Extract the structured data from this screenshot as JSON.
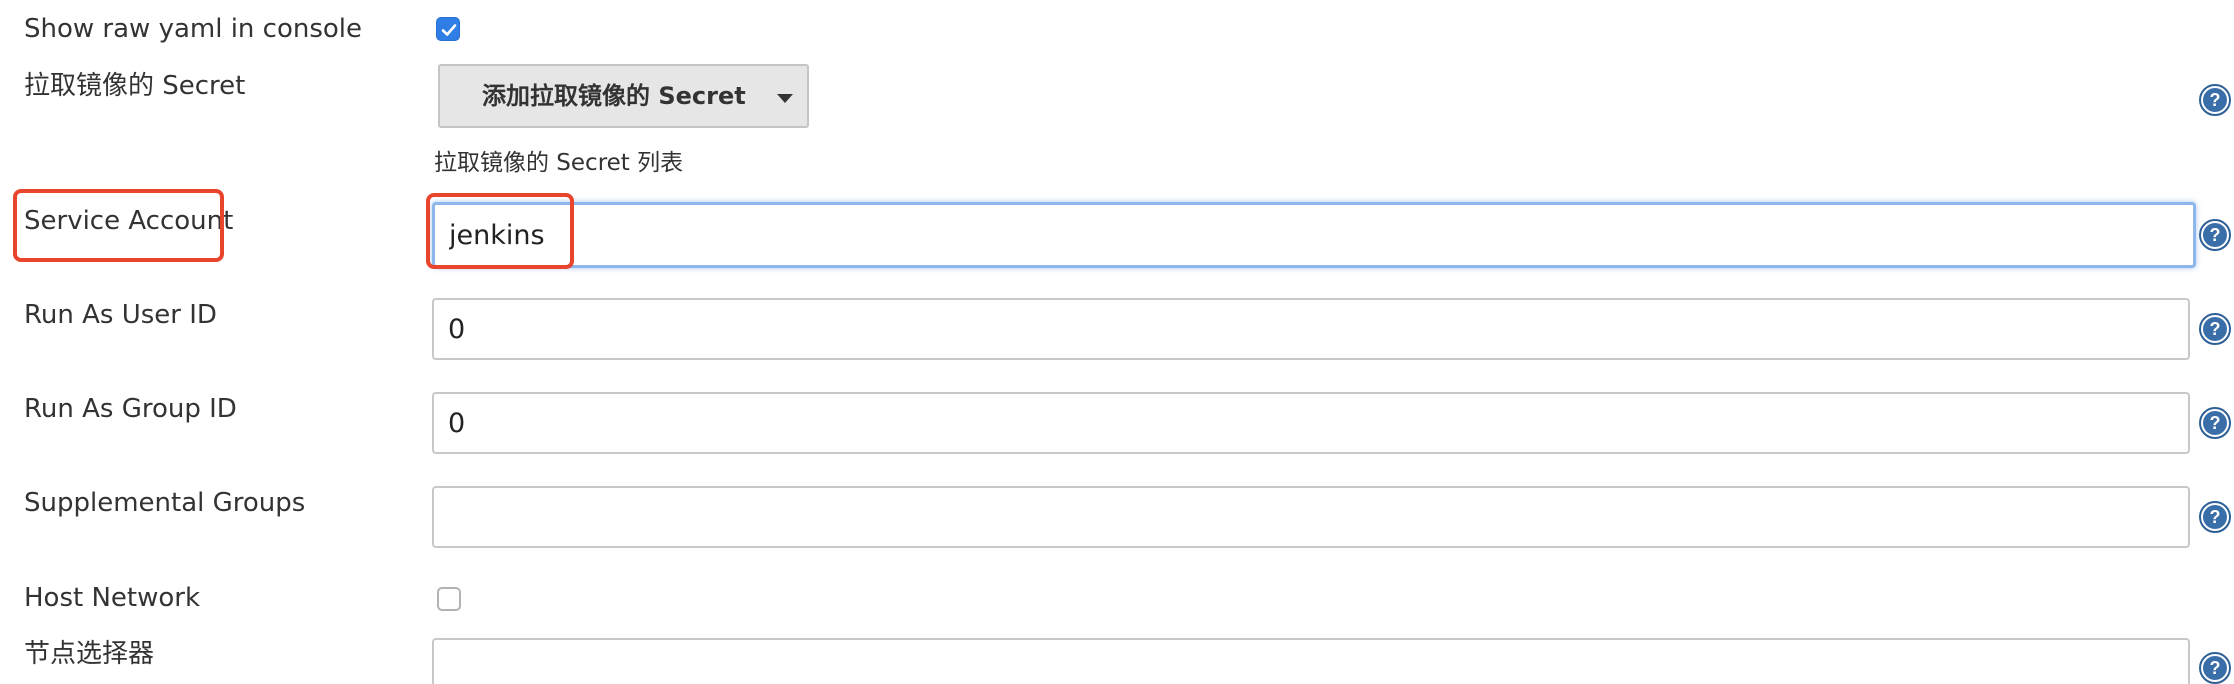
{
  "form": {
    "show_raw_yaml": {
      "label": "Show raw yaml in console",
      "checked": true
    },
    "image_pull_secret": {
      "label": "拉取镜像的 Secret",
      "button_label": "添加拉取镜像的 Secret",
      "hint": "拉取镜像的 Secret 列表"
    },
    "service_account": {
      "label": "Service Account",
      "value": "jenkins"
    },
    "run_as_user_id": {
      "label": "Run As User ID",
      "value": "0"
    },
    "run_as_group_id": {
      "label": "Run As Group ID",
      "value": "0"
    },
    "supplemental_groups": {
      "label": "Supplemental Groups",
      "value": ""
    },
    "host_network": {
      "label": "Host Network",
      "checked": false
    },
    "node_selector": {
      "label": "节点选择器",
      "value": ""
    }
  },
  "colors": {
    "highlight": "#e8452c",
    "checkbox_checked": "#2f7ee6",
    "focus_ring": "#8cb6ec",
    "help_icon": "#2e5f97"
  }
}
